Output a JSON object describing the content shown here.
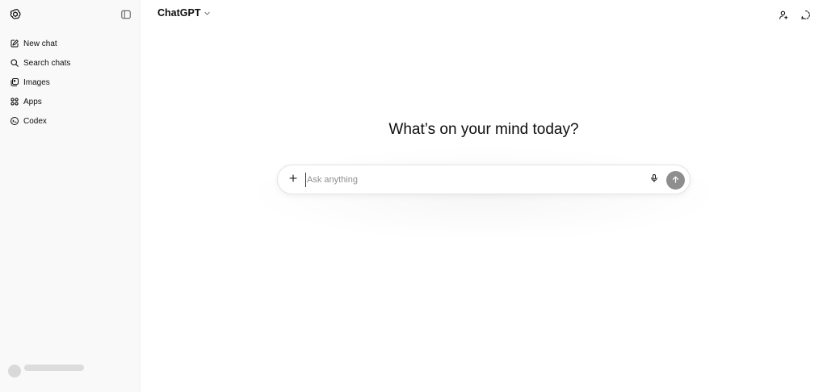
{
  "sidebar": {
    "logo_icon": "openai-logo-icon",
    "toggle_icon": "sidebar-toggle-icon",
    "items": [
      {
        "label": "New chat",
        "icon": "edit-icon"
      },
      {
        "label": "Search chats",
        "icon": "search-icon"
      },
      {
        "label": "Images",
        "icon": "images-icon"
      },
      {
        "label": "Apps",
        "icon": "apps-icon"
      },
      {
        "label": "Codex",
        "icon": "codex-icon"
      }
    ]
  },
  "header": {
    "model_label": "ChatGPT",
    "actions": [
      "add-person-icon",
      "temporary-chat-icon"
    ]
  },
  "main": {
    "heading": "What’s on your mind today?",
    "composer": {
      "placeholder": "Ask anything",
      "value": ""
    }
  },
  "colors": {
    "sidebar_bg": "#f9f9f9",
    "send_button": "#8e8e8e",
    "text": "#0d0d0d"
  }
}
